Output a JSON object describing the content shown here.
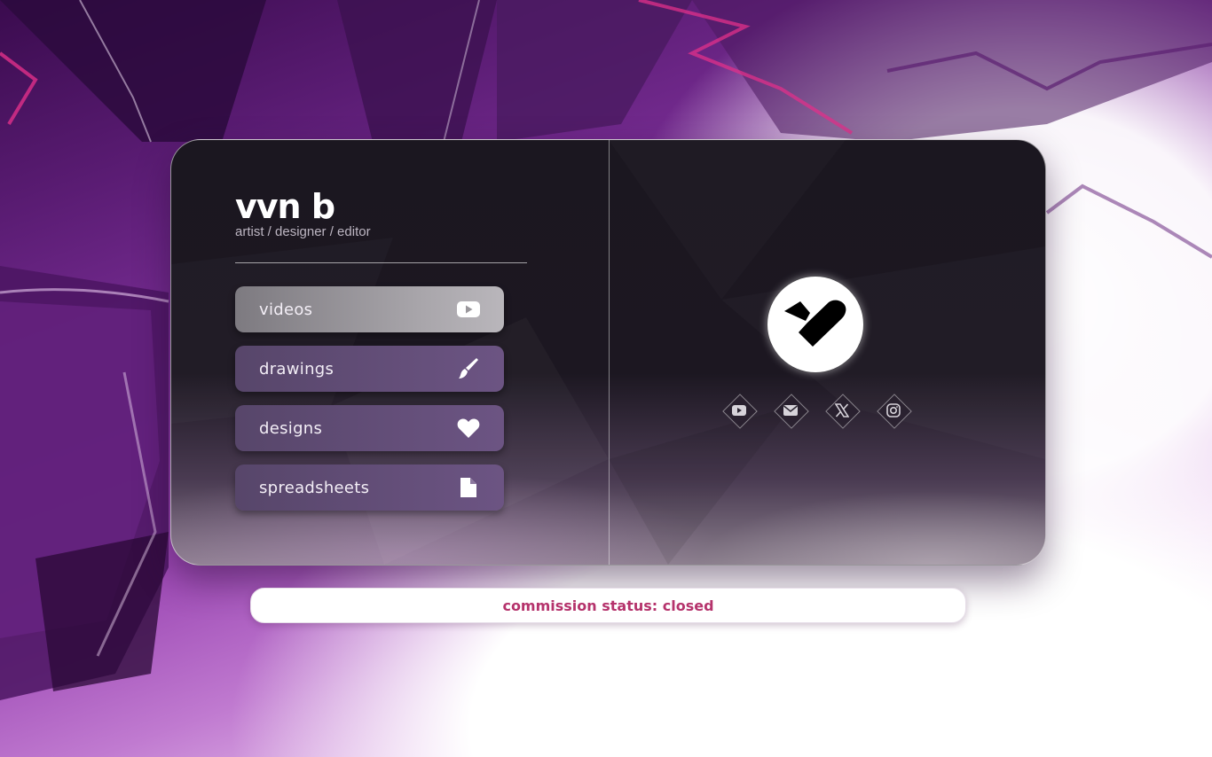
{
  "profile": {
    "name": "vvn b",
    "tagline": "artist / designer / editor"
  },
  "nav": [
    {
      "label": "videos",
      "icon": "youtube-icon",
      "active": true
    },
    {
      "label": "drawings",
      "icon": "paintbrush-icon",
      "active": false
    },
    {
      "label": "designs",
      "icon": "heart-icon",
      "active": false
    },
    {
      "label": "spreadsheets",
      "icon": "file-icon",
      "active": false
    }
  ],
  "logo": {
    "icon": "heart-logo-icon"
  },
  "socials": [
    {
      "name": "youtube",
      "icon": "youtube-icon"
    },
    {
      "name": "email",
      "icon": "envelope-icon"
    },
    {
      "name": "x",
      "icon": "x-icon"
    },
    {
      "name": "instagram",
      "icon": "instagram-icon"
    }
  ],
  "commission": {
    "text": "commission status: closed"
  },
  "colors": {
    "accent": "#b5336c",
    "button": "#6c5483",
    "button_active": "#a9a6ab",
    "card": "#1b1720"
  }
}
